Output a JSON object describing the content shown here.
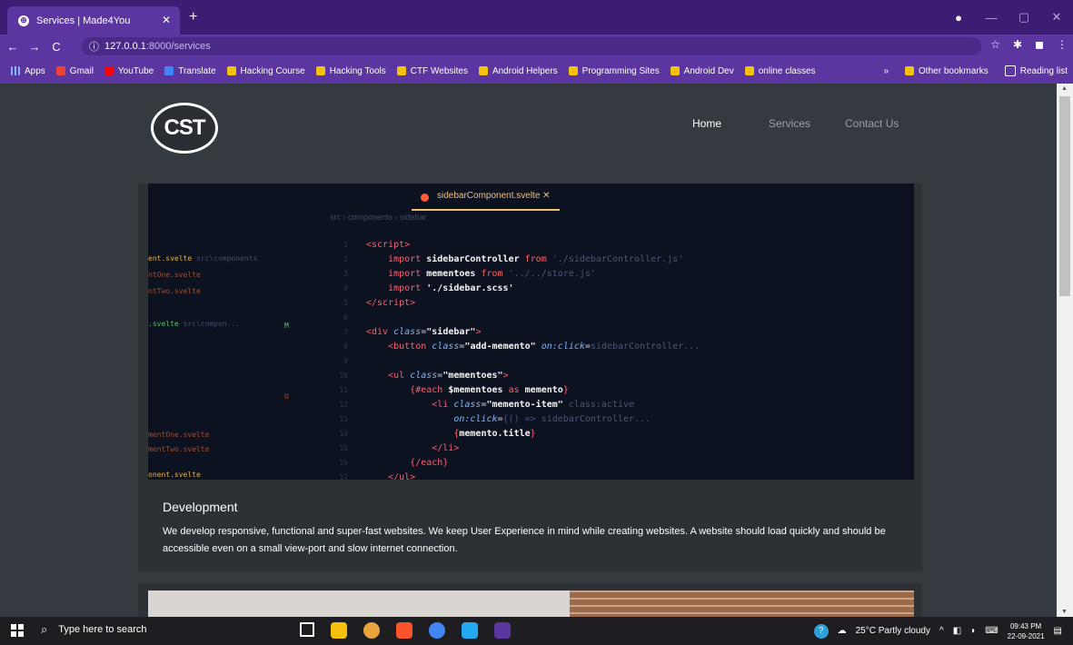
{
  "browser": {
    "tab_title": "Services | Made4You",
    "tab_close": "✕",
    "new_tab": "+",
    "window_controls": {
      "minimize": "—",
      "maximize": "▢",
      "close": "✕"
    },
    "nav": {
      "back": "←",
      "forward": "→",
      "reload": "C"
    },
    "url_info_icon": "ⓘ",
    "url_host": "127.0.0.1",
    "url_path": ":8000/services",
    "star": "☆"
  },
  "bookmarks": {
    "items": [
      {
        "label": "Apps",
        "icon": "apps-icon"
      },
      {
        "label": "Gmail",
        "icon": "gmail-icon"
      },
      {
        "label": "YouTube",
        "icon": "youtube-icon"
      },
      {
        "label": "Translate",
        "icon": "translate-icon"
      },
      {
        "label": "Hacking Course",
        "icon": "folder-icon"
      },
      {
        "label": "Hacking Tools",
        "icon": "folder-icon"
      },
      {
        "label": "CTF Websites",
        "icon": "folder-icon"
      },
      {
        "label": "Android Helpers",
        "icon": "folder-icon"
      },
      {
        "label": "Programming Sites",
        "icon": "folder-icon"
      },
      {
        "label": "Android Dev",
        "icon": "folder-icon"
      },
      {
        "label": "online classes",
        "icon": "folder-icon"
      }
    ],
    "overflow": "»",
    "other": "Other bookmarks",
    "reading": "Reading list"
  },
  "site": {
    "logo_text": "CST",
    "nav": {
      "home": "Home",
      "services": "Services",
      "contact": "Contact Us"
    },
    "card": {
      "title": "Development",
      "text": "We develop responsive, functional and super-fast websites. We keep User Experience in mind while creating websites. A website should load quickly and should be accessible even on a small view-port and slow internet connection.",
      "code_tab": "sidebarComponent.svelte ✕"
    }
  },
  "taskbar": {
    "search_placeholder": "Type here to search",
    "weather": "25°C  Partly cloudy",
    "time": "09:43 PM",
    "date": "22-09-2021"
  },
  "colors": {
    "titlebar": "#3b1d73",
    "toolbar": "#5b35a0",
    "page_bg": "#343a40",
    "card_bg": "#2c3136"
  }
}
